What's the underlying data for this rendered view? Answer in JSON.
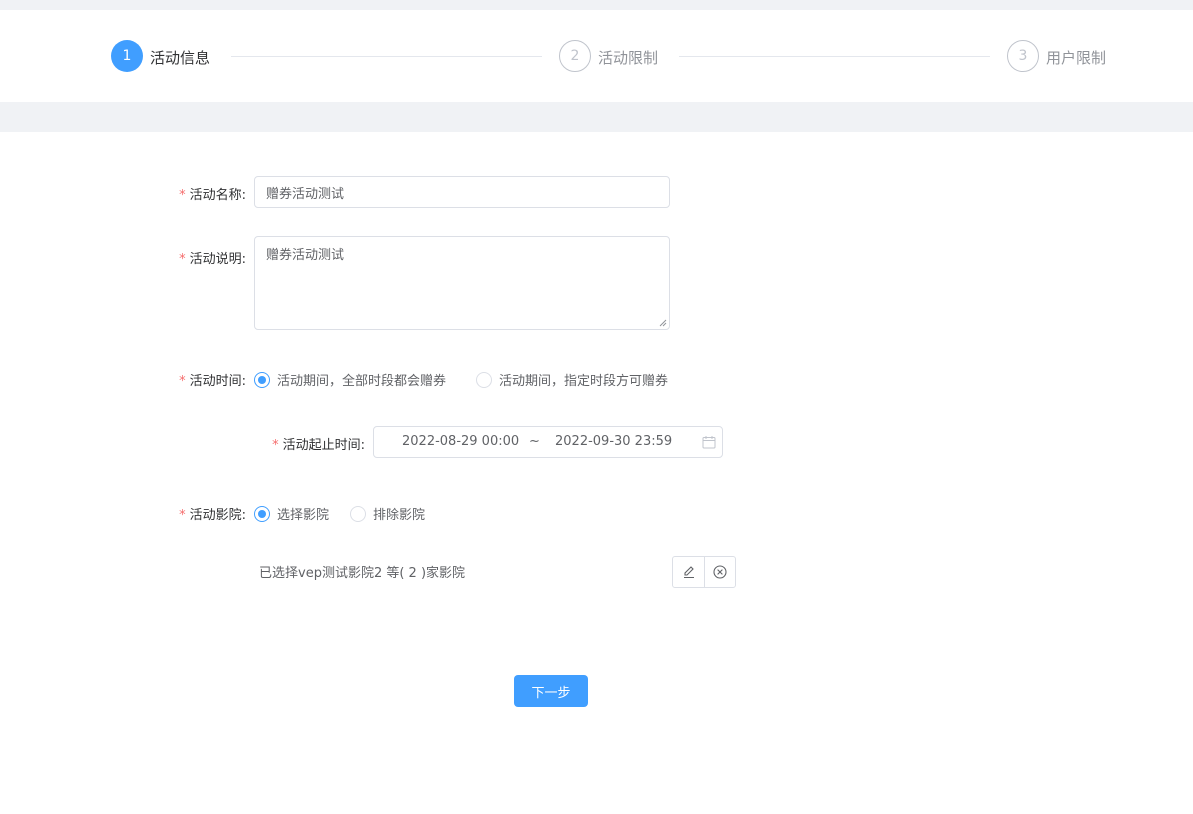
{
  "steps": [
    {
      "number": "1",
      "title": "活动信息"
    },
    {
      "number": "2",
      "title": "活动限制"
    },
    {
      "number": "3",
      "title": "用户限制"
    }
  ],
  "form": {
    "name": {
      "required_mark": "*",
      "label": "活动名称:",
      "value": "赠券活动测试"
    },
    "description": {
      "required_mark": "*",
      "label": "活动说明:",
      "value": "赠券活动测试"
    },
    "time": {
      "required_mark": "*",
      "label": "活动时间:",
      "options": [
        {
          "label": "活动期间，全部时段都会赠券",
          "checked": true
        },
        {
          "label": "活动期间，指定时段方可赠券",
          "checked": false
        }
      ]
    },
    "date_range": {
      "required_mark": "*",
      "label": "活动起止时间:",
      "start": "2022-08-29 00:00",
      "separator": "~",
      "end": "2022-09-30 23:59",
      "icon": "calendar-icon"
    },
    "cinema": {
      "required_mark": "*",
      "label": "活动影院:",
      "options": [
        {
          "label": "选择影院",
          "checked": true
        },
        {
          "label": "排除影院",
          "checked": false
        }
      ],
      "selected_summary": "已选择vep测试影院2 等( 2 )家影院",
      "edit_icon": "edit-icon",
      "clear_icon": "circle-close-icon"
    }
  },
  "next_button": "下一步",
  "colors": {
    "primary": "#409eff",
    "required": "#f56c6c",
    "background_gray": "#f0f2f5",
    "border": "#dcdfe6"
  }
}
